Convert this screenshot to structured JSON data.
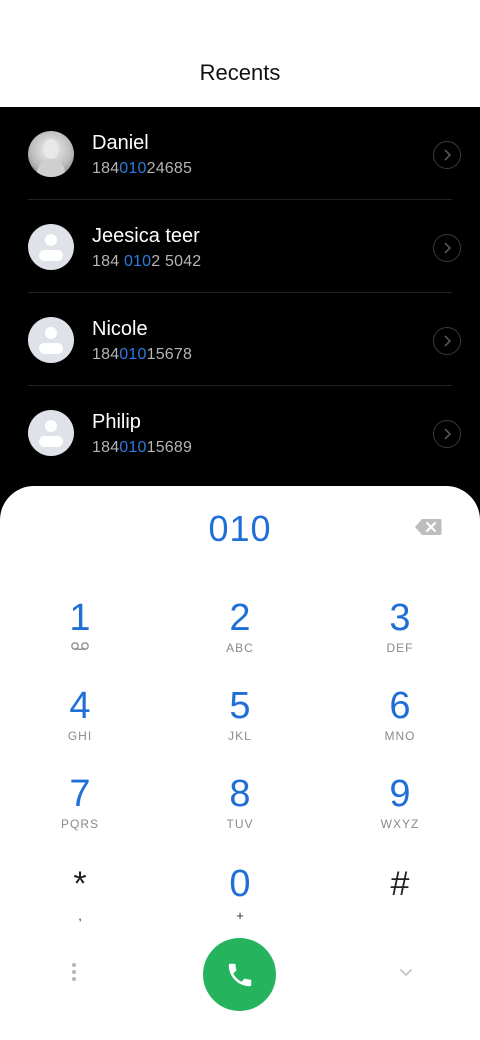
{
  "header": {
    "title": "Recents"
  },
  "recents": [
    {
      "name": "Daniel",
      "number_pre": "184",
      "number_hl": "010",
      "number_post": "24685",
      "avatar": "photo"
    },
    {
      "name": "Jeesica teer",
      "number_pre": "184 ",
      "number_hl": "010",
      "number_post": "2 5042",
      "avatar": "default"
    },
    {
      "name": "Nicole",
      "number_pre": "184",
      "number_hl": "010",
      "number_post": "15678",
      "avatar": "default"
    },
    {
      "name": "Philip",
      "number_pre": "184",
      "number_hl": "010",
      "number_post": "15689",
      "avatar": "default"
    }
  ],
  "dialer": {
    "typed_number": "010",
    "keys": [
      {
        "digit": "1",
        "letters": ""
      },
      {
        "digit": "2",
        "letters": "ABC"
      },
      {
        "digit": "3",
        "letters": "DEF"
      },
      {
        "digit": "4",
        "letters": "GHI"
      },
      {
        "digit": "5",
        "letters": "JKL"
      },
      {
        "digit": "6",
        "letters": "MNO"
      },
      {
        "digit": "7",
        "letters": "PQRS"
      },
      {
        "digit": "8",
        "letters": "TUV"
      },
      {
        "digit": "9",
        "letters": "WXYZ"
      },
      {
        "digit": "*",
        "letters": ","
      },
      {
        "digit": "0",
        "letters": "+"
      },
      {
        "digit": "#",
        "letters": ""
      }
    ]
  },
  "icons": {
    "voicemail": "voicemail-icon",
    "backspace": "backspace-icon",
    "call": "phone-icon",
    "more": "more-vertical-icon",
    "collapse": "chevron-down-icon",
    "details": "chevron-right-icon"
  },
  "colors": {
    "accent": "#1f6fd6",
    "call_green": "#25b35e",
    "list_bg": "#000000",
    "dialer_bg": "#ffffff"
  }
}
